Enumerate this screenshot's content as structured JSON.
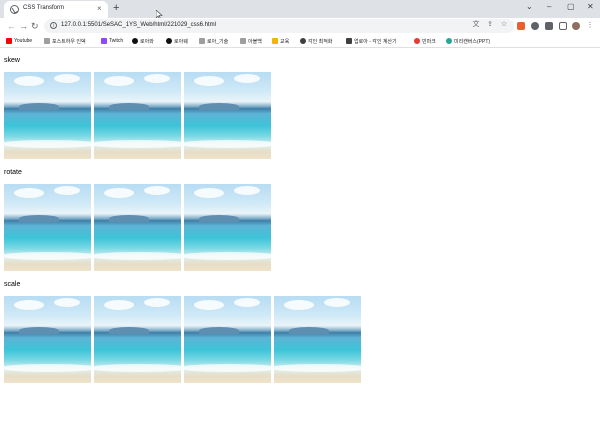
{
  "tab": {
    "title": "CSS Transform",
    "close": "×"
  },
  "newtab": "+",
  "window": {
    "minimize": "⌄",
    "min2": "–",
    "max": "▢",
    "close": "✕"
  },
  "toolbar": {
    "back": "←",
    "forward": "→",
    "reload": "↻"
  },
  "address": {
    "url": "127.0.0.1:5501/SeSAC_1YS_Web/html/221029_css6.html"
  },
  "bookmarks": [
    {
      "label": "Youtube",
      "color": "#ff0000"
    },
    {
      "label": "포스트하우 인덱",
      "color": "#9e9e9e"
    },
    {
      "label": "Twitch",
      "color": "#9146ff"
    },
    {
      "label": "로아와",
      "color": "#111111"
    },
    {
      "label": "로아웨",
      "color": "#111111"
    },
    {
      "label": "로아_기술",
      "color": "#9e9e9e"
    },
    {
      "label": "아볼백",
      "color": "#9e9e9e"
    },
    {
      "label": "교육",
      "color": "#f4b400"
    },
    {
      "label": "각인 최적화",
      "color": "#3c4043"
    },
    {
      "label": "업로아 - 각인 계산기",
      "color": "#3c4043"
    },
    {
      "label": "빈마크",
      "color": "#e53935"
    },
    {
      "label": "미리캔버스(PPT)",
      "color": "#26a69a"
    }
  ],
  "sections": [
    {
      "title": "skew",
      "count": 3
    },
    {
      "title": "rotate",
      "count": 3
    },
    {
      "title": "scale",
      "count": 4
    }
  ]
}
